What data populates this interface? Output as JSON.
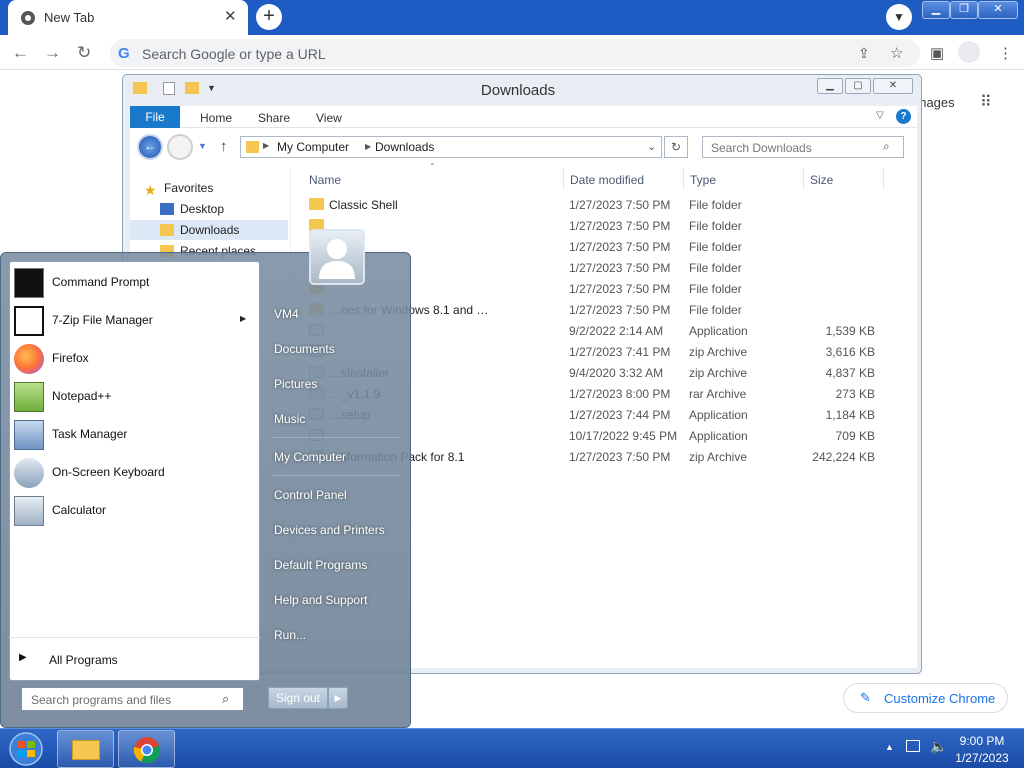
{
  "chrome": {
    "tab_title": "New Tab",
    "omnibox_placeholder": "Search Google or type a URL",
    "images_link": "Images",
    "customize_label": "Customize Chrome"
  },
  "explorer": {
    "title": "Downloads",
    "ribbon_tabs": [
      "File",
      "Home",
      "Share",
      "View"
    ],
    "breadcrumb": [
      "My Computer",
      "Downloads"
    ],
    "search_placeholder": "Search Downloads",
    "nav_items": [
      "Favorites",
      "Desktop",
      "Downloads",
      "Recent places"
    ],
    "columns": {
      "name": "Name",
      "date": "Date modified",
      "type": "Type",
      "size": "Size"
    },
    "files": [
      {
        "name": "Classic Shell",
        "date": "1/27/2023 7:50 PM",
        "type": "File folder",
        "size": ""
      },
      {
        "name": "",
        "date": "1/27/2023 7:50 PM",
        "type": "File folder",
        "size": ""
      },
      {
        "name": "",
        "date": "1/27/2023 7:50 PM",
        "type": "File folder",
        "size": ""
      },
      {
        "name": "",
        "date": "1/27/2023 7:50 PM",
        "type": "File folder",
        "size": ""
      },
      {
        "name": "",
        "date": "1/27/2023 7:50 PM",
        "type": "File folder",
        "size": ""
      },
      {
        "name": "…nes for Windows 8.1 and …",
        "date": "1/27/2023 7:50 PM",
        "type": "File folder",
        "size": ""
      },
      {
        "name": "",
        "date": "9/2/2022 2:14 AM",
        "type": "Application",
        "size": "1,539 KB"
      },
      {
        "name": "",
        "date": "1/27/2023 7:41 PM",
        "type": "zip Archive",
        "size": "3,616 KB"
      },
      {
        "name": "…sInstaller",
        "date": "9/4/2020 3:32 AM",
        "type": "zip Archive",
        "size": "4,837 KB"
      },
      {
        "name": "…_v1.1.9",
        "date": "1/27/2023 8:00 PM",
        "type": "rar Archive",
        "size": "273 KB"
      },
      {
        "name": "…setup",
        "date": "1/27/2023 7:44 PM",
        "type": "Application",
        "size": "1,184 KB"
      },
      {
        "name": "",
        "date": "10/17/2022 9:45 PM",
        "type": "Application",
        "size": "709 KB"
      },
      {
        "name": "…sformation Pack for 8.1",
        "date": "1/27/2023 7:50 PM",
        "type": "zip Archive",
        "size": "242,224 KB"
      }
    ]
  },
  "start_menu": {
    "programs": [
      {
        "label": "Command Prompt",
        "icon": "cmd-icon"
      },
      {
        "label": "7-Zip File Manager",
        "icon": "7zip-icon"
      },
      {
        "label": "Firefox",
        "icon": "firefox-icon"
      },
      {
        "label": "Notepad++",
        "icon": "notepadpp-icon"
      },
      {
        "label": "Task Manager",
        "icon": "task-manager-icon"
      },
      {
        "label": "On-Screen Keyboard",
        "icon": "keyboard-icon"
      },
      {
        "label": "Calculator",
        "icon": "calculator-icon"
      }
    ],
    "all_programs": "All Programs",
    "search_placeholder": "Search programs and files",
    "right_links": [
      "VM4",
      "Documents",
      "Pictures",
      "Music",
      "My Computer",
      "Control Panel",
      "Devices and Printers",
      "Default Programs",
      "Help and Support",
      "Run..."
    ],
    "sign_out": "Sign out"
  },
  "taskbar": {
    "time": "9:00 PM",
    "date": "1/27/2023"
  },
  "colors": {
    "chrome_frame": "#1e5cc4",
    "taskbar": "#1f55b5",
    "file_tab": "#1979ca",
    "folder": "#f5c650"
  }
}
